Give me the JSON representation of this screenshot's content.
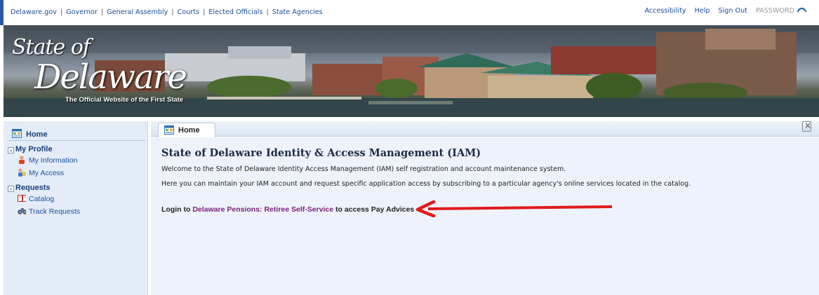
{
  "topnav": {
    "links": [
      "Delaware.gov",
      "Governor",
      "General Assembly",
      "Courts",
      "Elected Officials",
      "State Agencies"
    ],
    "sep": "|"
  },
  "utility": {
    "accessibility": "Accessibility",
    "help": "Help",
    "sign_out": "Sign Out",
    "password": "PASSWORD"
  },
  "banner": {
    "logo_state": "State of",
    "logo_name": "Delaware",
    "tagline": "The Official Website of the First State"
  },
  "sidebar": {
    "home": "Home",
    "sections": [
      {
        "title": "My Profile",
        "toggle": "⌄",
        "items": [
          "My Information",
          "My Access"
        ]
      },
      {
        "title": "Requests",
        "toggle": "⌄",
        "items": [
          "Catalog",
          "Track Requests"
        ]
      }
    ]
  },
  "tab": {
    "label": "Home"
  },
  "main": {
    "title": "State of Delaware Identity & Access Management (IAM)",
    "para1": "Welcome to the State of Delaware Identity Access Management (IAM) self registration and account maintenance system.",
    "para2": "Here you can maintain your IAM account and request specific application access by subscribing to a particular agency's online services located in the catalog.",
    "login_prefix": "Login to ",
    "login_link": "Delaware Pensions: Retiree Self-Service",
    "login_suffix": " to access Pay Advices"
  },
  "colors": {
    "link": "#1a4f9c",
    "link_visited": "#7a1f78",
    "arrow": "#e01b1b",
    "sidebar_bg": "#e4ecf7"
  }
}
